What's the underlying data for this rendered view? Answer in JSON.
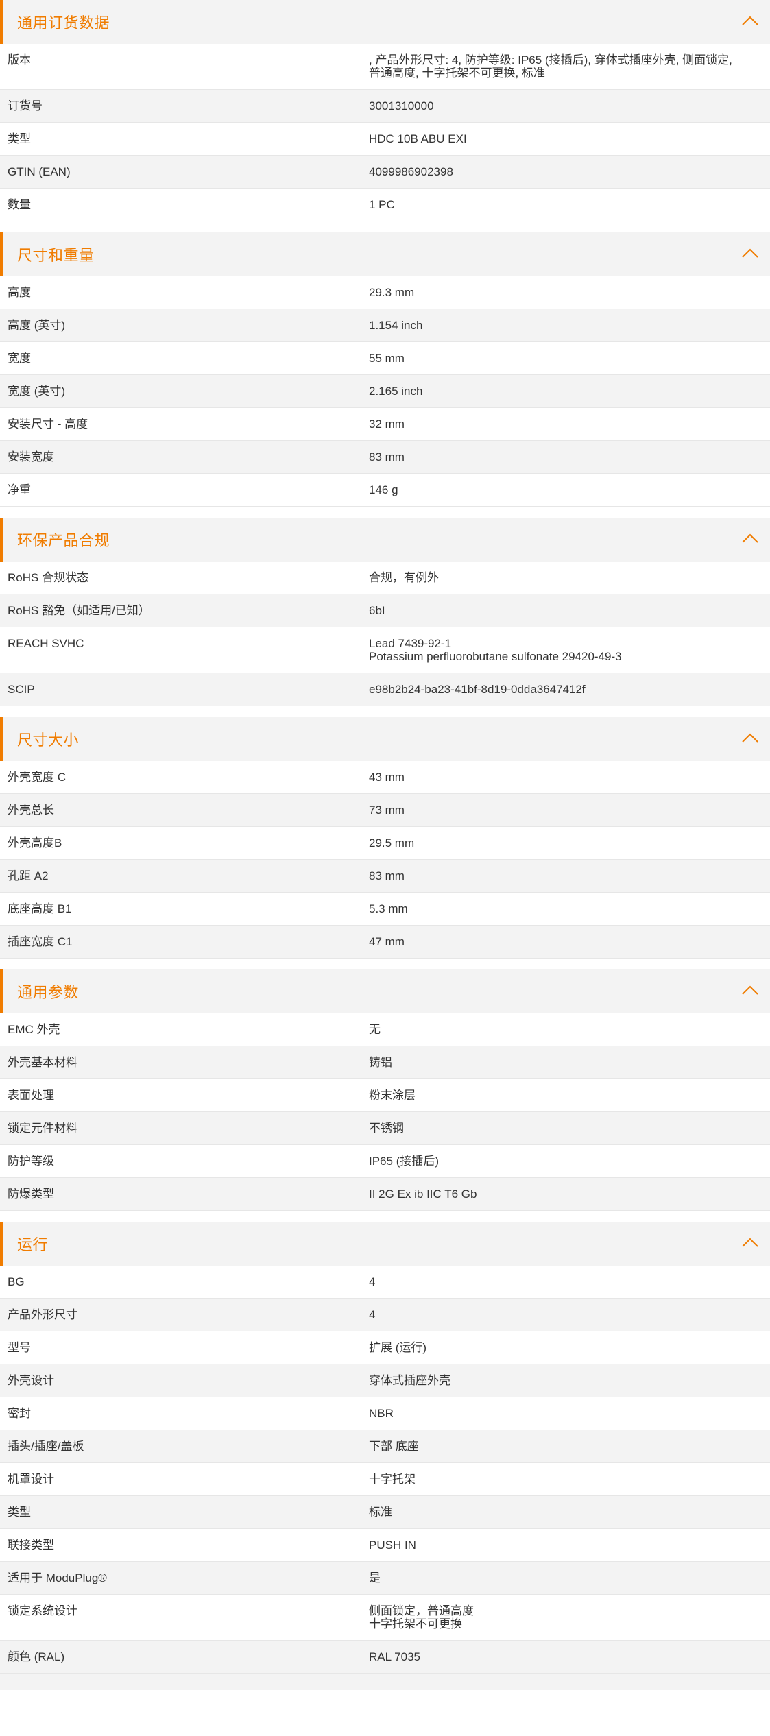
{
  "accent": "#f07c00",
  "sections": [
    {
      "title": "通用订货数据",
      "rows": [
        {
          "label": "版本",
          "value": ", 产品外形尺寸: 4, 防护等级: IP65 (接插后), 穿体式插座外壳, 侧面锁定,\n普通高度, 十字托架不可更换, 标准"
        },
        {
          "label": "订货号",
          "value": "3001310000"
        },
        {
          "label": "类型",
          "value": "HDC 10B ABU EXI"
        },
        {
          "label": "GTIN (EAN)",
          "value": "4099986902398"
        },
        {
          "label": "数量",
          "value": "1  PC"
        }
      ]
    },
    {
      "title": "尺寸和重量",
      "rows": [
        {
          "label": "高度",
          "value": "29.3  mm"
        },
        {
          "label": "高度 (英寸)",
          "value": "1.154  inch"
        },
        {
          "label": "宽度",
          "value": "55  mm"
        },
        {
          "label": "宽度 (英寸)",
          "value": "2.165  inch"
        },
        {
          "label": "安装尺寸 - 高度",
          "value": "32  mm"
        },
        {
          "label": "安装宽度",
          "value": "83  mm"
        },
        {
          "label": "净重",
          "value": "146  g"
        }
      ]
    },
    {
      "title": "环保产品合规",
      "rows": [
        {
          "label": "RoHS 合规状态",
          "value": "合规，有例外"
        },
        {
          "label": "RoHS 豁免（如适用/已知）",
          "value": "6bI"
        },
        {
          "label": "REACH SVHC",
          "value": "Lead 7439-92-1\nPotassium perfluorobutane sulfonate 29420-49-3"
        },
        {
          "label": "SCIP",
          "value": "e98b2b24-ba23-41bf-8d19-0dda3647412f"
        }
      ]
    },
    {
      "title": "尺寸大小",
      "rows": [
        {
          "label": "外壳宽度 C",
          "value": "43  mm"
        },
        {
          "label": "外壳总长",
          "value": "73  mm"
        },
        {
          "label": "外壳高度B",
          "value": "29.5  mm"
        },
        {
          "label": "孔距 A2",
          "value": "83  mm"
        },
        {
          "label": "底座高度 B1",
          "value": "5.3  mm"
        },
        {
          "label": "插座宽度 C1",
          "value": "47  mm"
        }
      ]
    },
    {
      "title": "通用参数",
      "rows": [
        {
          "label": "EMC 外壳",
          "value": "无"
        },
        {
          "label": "外壳基本材料",
          "value": "铸铝"
        },
        {
          "label": "表面处理",
          "value": "粉末涂层"
        },
        {
          "label": "锁定元件材料",
          "value": "不锈钢"
        },
        {
          "label": "防护等级",
          "value": "IP65 (接插后)"
        },
        {
          "label": "防爆类型",
          "value": "II 2G Ex ib IIC T6 Gb"
        }
      ]
    },
    {
      "title": "运行",
      "rows": [
        {
          "label": "BG",
          "value": "4"
        },
        {
          "label": "产品外形尺寸",
          "value": "4"
        },
        {
          "label": "型号",
          "value": "扩展 (运行)"
        },
        {
          "label": "外壳设计",
          "value": "穿体式插座外壳"
        },
        {
          "label": "密封",
          "value": "NBR"
        },
        {
          "label": "插头/插座/盖板",
          "value": "下部 底座"
        },
        {
          "label": "机罩设计",
          "value": "十字托架"
        },
        {
          "label": "类型",
          "value": "标准"
        },
        {
          "label": "联接类型",
          "value": "PUSH IN"
        },
        {
          "label": "适用于 ModuPlug®",
          "value": "是"
        },
        {
          "label": "锁定系统设计",
          "value": "侧面锁定，普通高度\n十字托架不可更换"
        },
        {
          "label": "颜色 (RAL)",
          "value": "RAL 7035"
        }
      ]
    }
  ]
}
